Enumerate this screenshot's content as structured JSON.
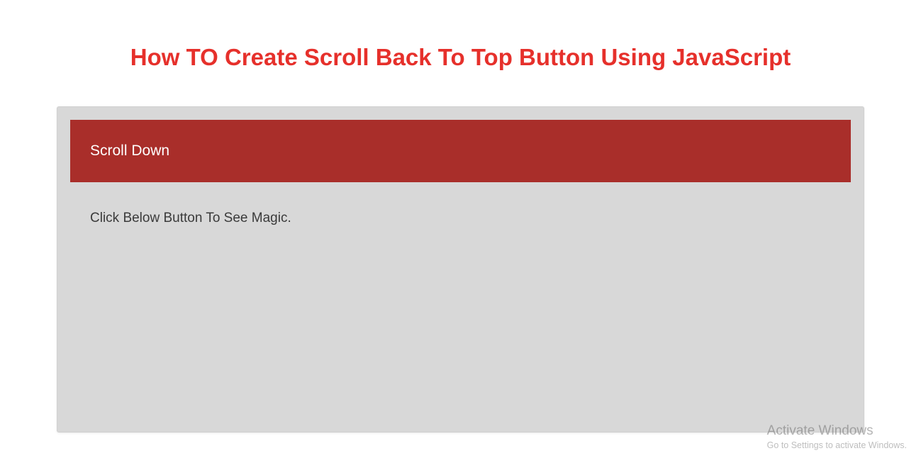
{
  "page": {
    "title": "How TO Create Scroll Back To Top Button Using JavaScript"
  },
  "panel": {
    "header": "Scroll Down",
    "body": "Click Below Button To See Magic."
  },
  "watermark": {
    "title": "Activate Windows",
    "subtitle": "Go to Settings to activate Windows."
  },
  "colors": {
    "accent": "#e6302b",
    "header_bg": "#a92e2a",
    "panel_bg": "#d8d8d8"
  }
}
